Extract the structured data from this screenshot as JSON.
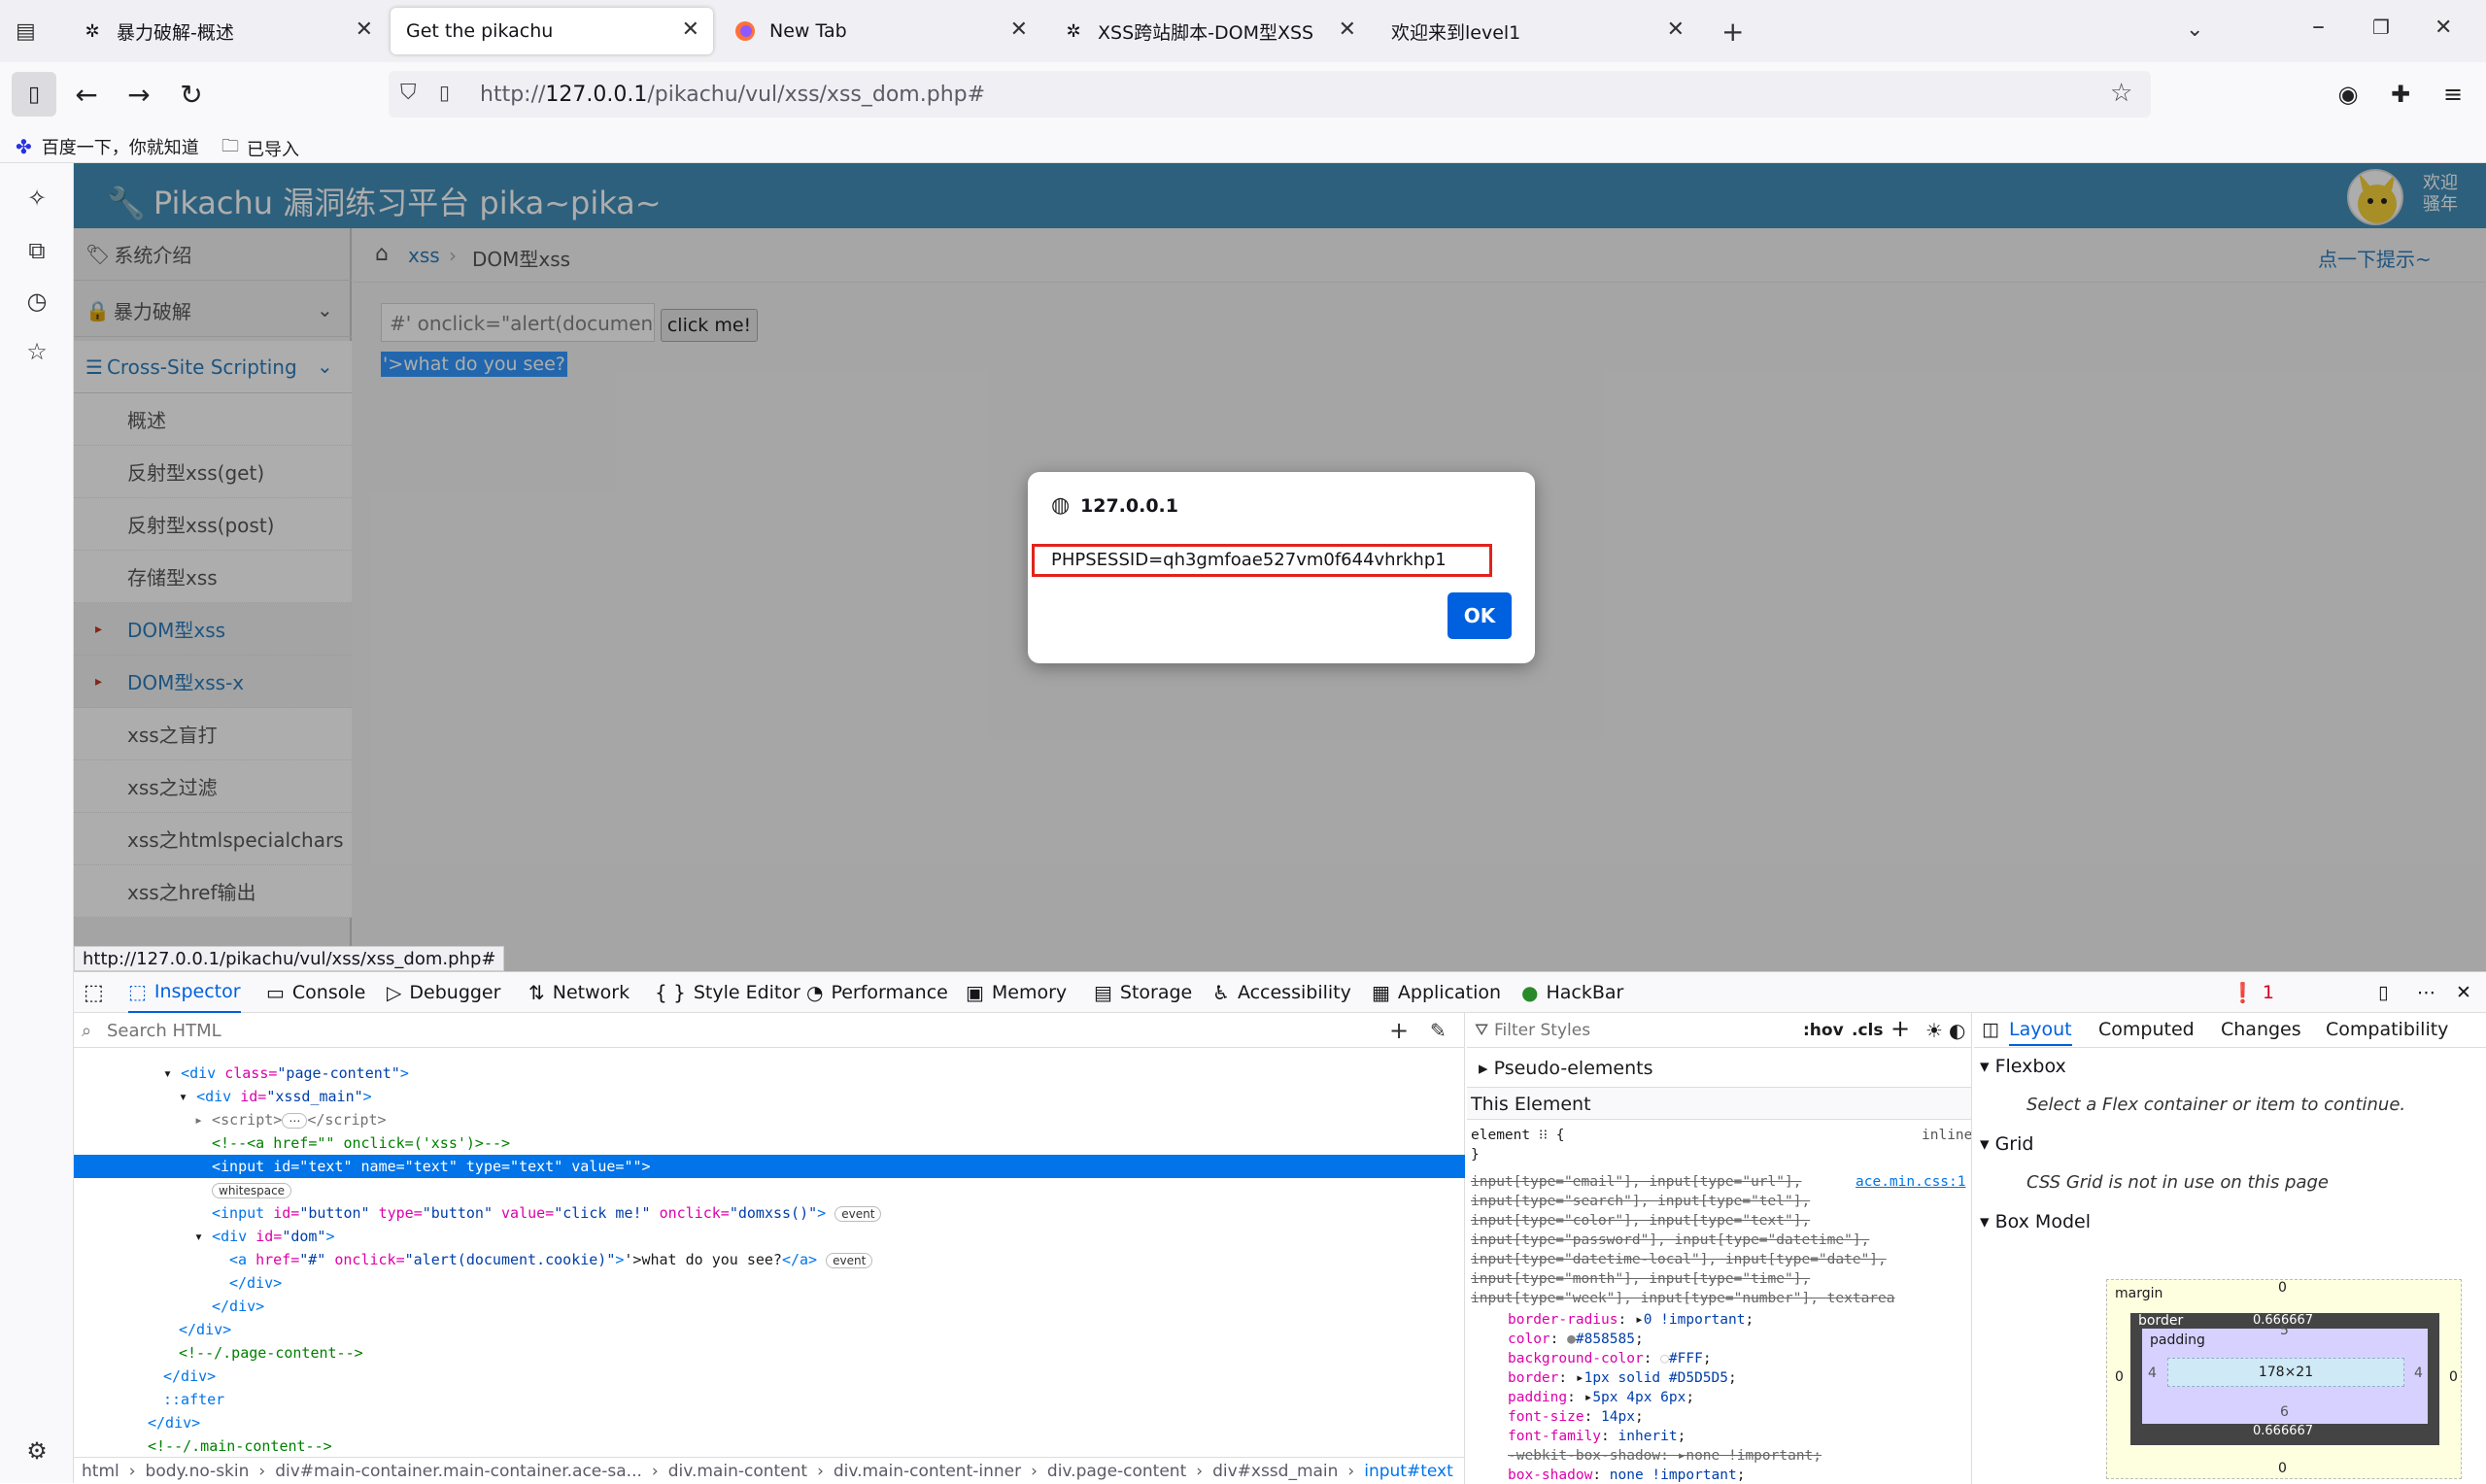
{
  "browser": {
    "tabs": [
      {
        "title": "暴力破解-概述",
        "icon": "bug-icon"
      },
      {
        "title": "Get the pikachu",
        "icon": "none",
        "active": true
      },
      {
        "title": "New Tab",
        "icon": "firefox-icon"
      },
      {
        "title": "XSS跨站脚本-DOM型XSS",
        "icon": "bug-icon"
      },
      {
        "title": "欢迎来到level1",
        "icon": "none"
      }
    ],
    "url_prefix": "http://",
    "url_host": "127.0.0.1",
    "url_path": "/pikachu/vul/xss/xss_dom.php#",
    "bookmarks": [
      {
        "label": "百度一下，你就知道",
        "icon": "paw-icon"
      },
      {
        "label": "已导入",
        "icon": "folder-icon"
      }
    ],
    "status_link": "http://127.0.0.1/pikachu/vul/xss/xss_dom.php#"
  },
  "page": {
    "header_title": "Pikachu 漏洞练习平台 pika~pika~",
    "user_greeting_1": "欢迎",
    "user_greeting_2": "骚年",
    "hint": "点一下提示~",
    "breadcrumb": [
      "xss",
      "DOM型xss"
    ],
    "sidebar": {
      "sections": [
        "系统介绍",
        "暴力破解",
        "Cross-Site Scripting"
      ],
      "items": [
        "概述",
        "反射型xss(get)",
        "反射型xss(post)",
        "存储型xss",
        "DOM型xss",
        "DOM型xss-x",
        "xss之盲打",
        "xss之过滤",
        "xss之htmlspecialchars",
        "xss之href输出"
      ]
    },
    "input_value": "#' onclick=\"alert(document.",
    "button_label": "click me!",
    "link_text": "'>what do you see?"
  },
  "dialog": {
    "origin": "127.0.0.1",
    "message": "PHPSESSID=qh3gmfoae527vm0f644vhrkhp1",
    "ok_label": "OK",
    "highlight_color": "#e0241c"
  },
  "devtools": {
    "tabs": [
      "Inspector",
      "Console",
      "Debugger",
      "Network",
      "Style Editor",
      "Performance",
      "Memory",
      "Storage",
      "Accessibility",
      "Application",
      "HackBar"
    ],
    "error_count": "1",
    "search_placeholder": "Search HTML",
    "breadcrumb": [
      "html",
      "body.no-skin",
      "div#main-container.main-container.ace-sa...",
      "div.main-content",
      "div.main-content-inner",
      "div.page-content",
      "div#xssd_main",
      "input#text"
    ],
    "rules": {
      "filter_placeholder": "Filter Styles",
      "hov": ":hov",
      "cls": ".cls",
      "pseudo": "Pseudo-elements",
      "this_element": "This Element",
      "element_rule": "element",
      "inline": "inline",
      "source": "ace.min.css:1",
      "selectors": [
        "input[type=\"email\"], input[type=\"url\"],",
        "input[type=\"search\"], input[type=\"tel\"],",
        "input[type=\"color\"], input[type=\"text\"],",
        "input[type=\"password\"], input[type=\"datetime\"],",
        "input[type=\"datetime-local\"], input[type=\"date\"],",
        "input[type=\"month\"], input[type=\"time\"],",
        "input[type=\"week\"], input[type=\"number\"], textarea"
      ],
      "declarations": [
        {
          "prop": "border-radius",
          "value": "0 !important"
        },
        {
          "prop": "color",
          "value": "#858585"
        },
        {
          "prop": "background-color",
          "value": "#FFF"
        },
        {
          "prop": "border",
          "value": "1px solid #D5D5D5"
        },
        {
          "prop": "padding",
          "value": "5px 4px 6px"
        },
        {
          "prop": "font-size",
          "value": "14px"
        },
        {
          "prop": "font-family",
          "value": "inherit"
        },
        {
          "prop": "-webkit-box-shadow",
          "value": "none !important"
        },
        {
          "prop": "box-shadow",
          "value": "none !important"
        }
      ]
    },
    "layout": {
      "tabs": [
        "Layout",
        "Computed",
        "Changes",
        "Compatibility"
      ],
      "flexbox": "Flexbox",
      "flexbox_note": "Select a Flex container or item to continue.",
      "grid": "Grid",
      "grid_note": "CSS Grid is not in use on this page",
      "boxmodel": "Box Model",
      "bm_margin": "margin",
      "bm_border": "border",
      "bm_padding": "padding",
      "bm_content": "178×21",
      "bm_margin_top": "0",
      "bm_margin_bottom": "0",
      "bm_margin_left": "0",
      "bm_margin_right": "0",
      "bm_border_val": "0.666667",
      "bm_pad_top": "5",
      "bm_pad_bottom": "6",
      "bm_pad_left": "4",
      "bm_pad_right": "4"
    }
  }
}
